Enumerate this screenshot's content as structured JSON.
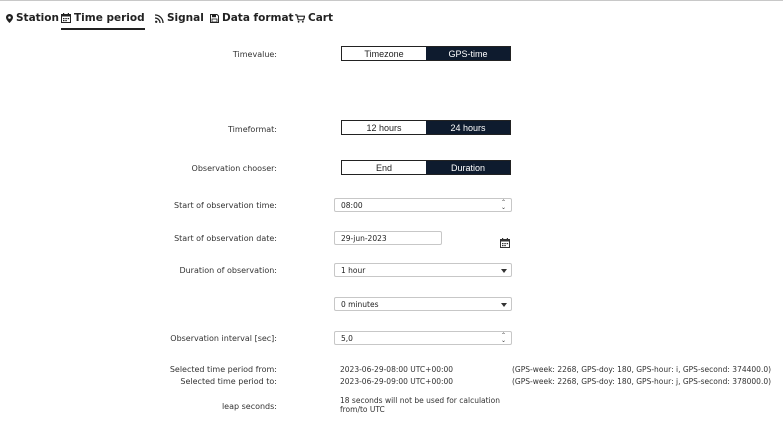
{
  "tabs": [
    {
      "label": "Station",
      "icon": "map-marker-icon"
    },
    {
      "label": "Time period",
      "icon": "calendar-icon"
    },
    {
      "label": "Signal",
      "icon": "rss-icon"
    },
    {
      "label": "Data format",
      "icon": "floppy-disk-icon"
    },
    {
      "label": "Cart",
      "icon": "cart-icon"
    }
  ],
  "active_tab": "Time period",
  "timevalue": {
    "label": "Timevalue:",
    "options": [
      "Timezone",
      "GPS-time"
    ],
    "selected": "GPS-time"
  },
  "timeformat": {
    "label": "Timeformat:",
    "options": [
      "12 hours",
      "24 hours"
    ],
    "selected": "24 hours"
  },
  "observation_chooser": {
    "label": "Observation chooser:",
    "options": [
      "End",
      "Duration"
    ],
    "selected": "Duration"
  },
  "start_time": {
    "label": "Start of observation time:",
    "value": "08:00"
  },
  "start_date": {
    "label": "Start of observation date:",
    "value": "29-jun-2023"
  },
  "duration": {
    "label": "Duration of observation:",
    "hours_value": "1 hour",
    "minutes_value": "0 minutes"
  },
  "interval": {
    "label": "Observation interval [sec]:",
    "value": "5,0"
  },
  "period_from": {
    "label": "Selected time period from:",
    "value": "2023-06-29-08:00 UTC+00:00",
    "gps": "(GPS-week: 2268, GPS-doy: 180, GPS-hour: i, GPS-second: 374400.0)"
  },
  "period_to": {
    "label": "Selected time period to:",
    "value": "2023-06-29-09:00 UTC+00:00",
    "gps": "(GPS-week: 2268, GPS-doy: 180, GPS-hour: j, GPS-second: 378000.0)"
  },
  "leap_seconds": {
    "label": "leap seconds:",
    "line1": "18 seconds will not be used for calculation",
    "line2": "from/to UTC"
  },
  "colors": {
    "selected_segment": "#0e1b2e",
    "border": "#c7c7c7"
  }
}
